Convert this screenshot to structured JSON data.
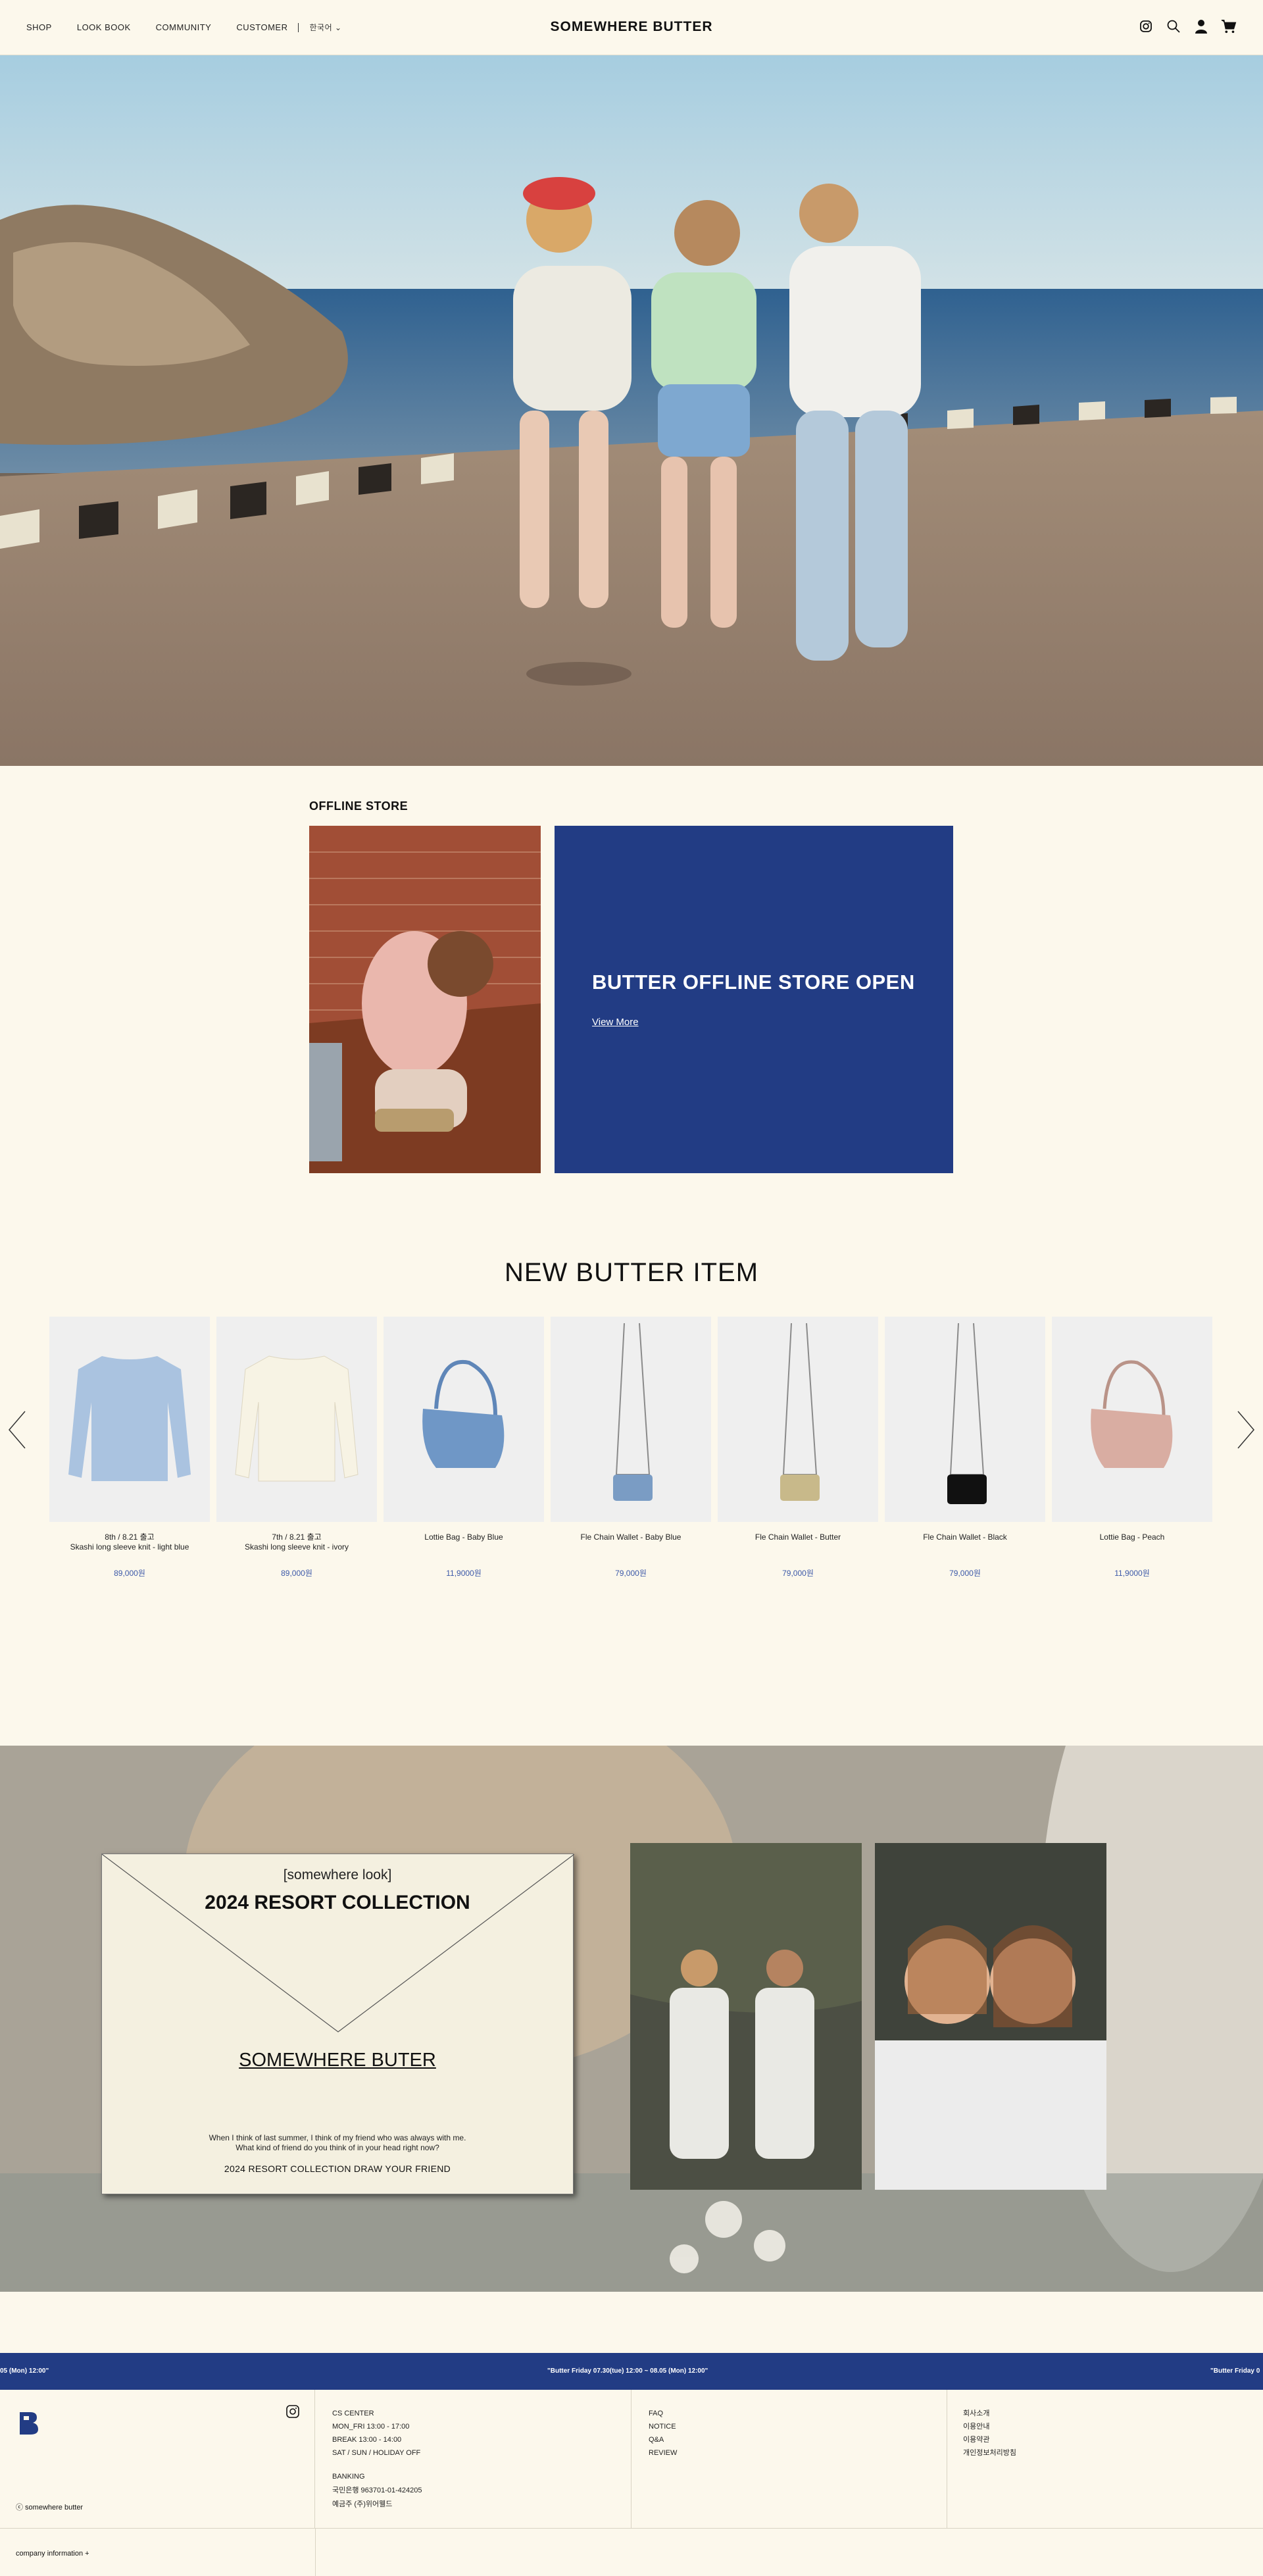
{
  "header": {
    "nav": [
      "SHOP",
      "LOOK BOOK",
      "COMMUNITY",
      "CUSTOMER"
    ],
    "language": "한국어",
    "logo": "SOMEWHERE BUTTER",
    "icons": [
      "instagram-icon",
      "search-icon",
      "user-icon",
      "cart-icon"
    ]
  },
  "offline": {
    "title": "OFFLINE STORE",
    "headline": "BUTTER OFFLINE STORE OPEN",
    "view_more": "View More"
  },
  "new_items": {
    "title": "NEW BUTTER ITEM",
    "products": [
      {
        "line1": "8th / 8.21 출고",
        "line2": "Skashi long sleeve knit - light blue",
        "price": "89,000원"
      },
      {
        "line1": "7th / 8.21 출고",
        "line2": "Skashi long sleeve knit - ivory",
        "price": "89,000원"
      },
      {
        "line1": "Lottie Bag - Baby Blue",
        "line2": "",
        "price": "11,9000원"
      },
      {
        "line1": "Fle Chain Wallet - Baby Blue",
        "line2": "",
        "price": "79,000원"
      },
      {
        "line1": "Fle Chain Wallet - Butter",
        "line2": "",
        "price": "79,000원"
      },
      {
        "line1": "Fle Chain Wallet - Black",
        "line2": "",
        "price": "79,000원"
      },
      {
        "line1": "Lottie Bag - Peach",
        "line2": "",
        "price": "11,9000원"
      }
    ]
  },
  "resort": {
    "look": "[somewhere look]",
    "title": "2024 RESORT COLLECTION",
    "brand": "SOMEWHERE BUTER",
    "text1": "When I think of last summer, I think of my friend who was always with me.",
    "text2": "What kind of friend do you think of in your head right now?",
    "draw": "2024 RESORT COLLECTION DRAW YOUR FRIEND"
  },
  "ticker": {
    "left": "05 (Mon) 12:00\"",
    "center": "\"Butter Friday 07.30(tue) 12:00 ~ 08.05 (Mon) 12:00\"",
    "right": "\"Butter Friday 0"
  },
  "footer": {
    "copyright": "ⓒ somewhere butter",
    "company_info": "company information +",
    "cs": [
      "CS CENTER",
      "MON_FRI  13:00 - 17:00",
      "BREAK  13:00 - 14:00",
      "SAT / SUN / HOLIDAY OFF"
    ],
    "banking": [
      "BANKING",
      "국민은행  963701-01-424205",
      "예금주 (주)위어웰드"
    ],
    "links1": [
      "FAQ",
      "NOTICE",
      "Q&A",
      "REVIEW"
    ],
    "links2": [
      "회사소개",
      "이용안내",
      "이용약관",
      "개인정보처리방침"
    ]
  },
  "colors": {
    "accent": "#223c84",
    "background": "#fcf8ec",
    "price": "#3b58a8"
  }
}
